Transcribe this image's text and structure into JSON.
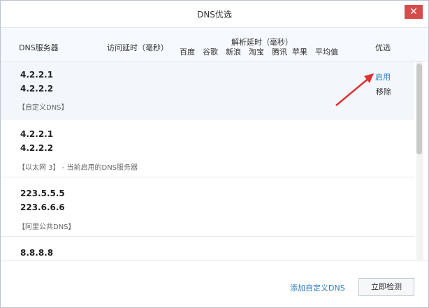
{
  "window": {
    "title": "DNS优选",
    "close_glyph": "✕"
  },
  "columns": {
    "server": "DNS服务器",
    "latency": "访问延时（毫秒）",
    "resolve_group": "解析延时（毫秒）",
    "resolve_sites": [
      "百度",
      "谷歌",
      "新浪",
      "淘宝",
      "腾讯",
      "苹果",
      "平均值"
    ],
    "select": "优选"
  },
  "rows": [
    {
      "ip1": "4.2.2.1",
      "ip2": "4.2.2.2",
      "note": "【自定义DNS】",
      "action1": "启用",
      "action2": "移除"
    },
    {
      "ip1": "4.2.2.1",
      "ip2": "4.2.2.2",
      "note": "【以太网 3】 - 当前启用的DNS服务器"
    },
    {
      "ip1": "223.5.5.5",
      "ip2": "223.6.6.6",
      "note": "【阿里公共DNS】"
    },
    {
      "ip1": "8.8.8.8"
    }
  ],
  "footer": {
    "add_link": "添加自定义DNS",
    "detect_button": "立即检测"
  },
  "colors": {
    "link": "#2a79c5",
    "arrow": "#e03030",
    "close": "#d64b4b"
  }
}
